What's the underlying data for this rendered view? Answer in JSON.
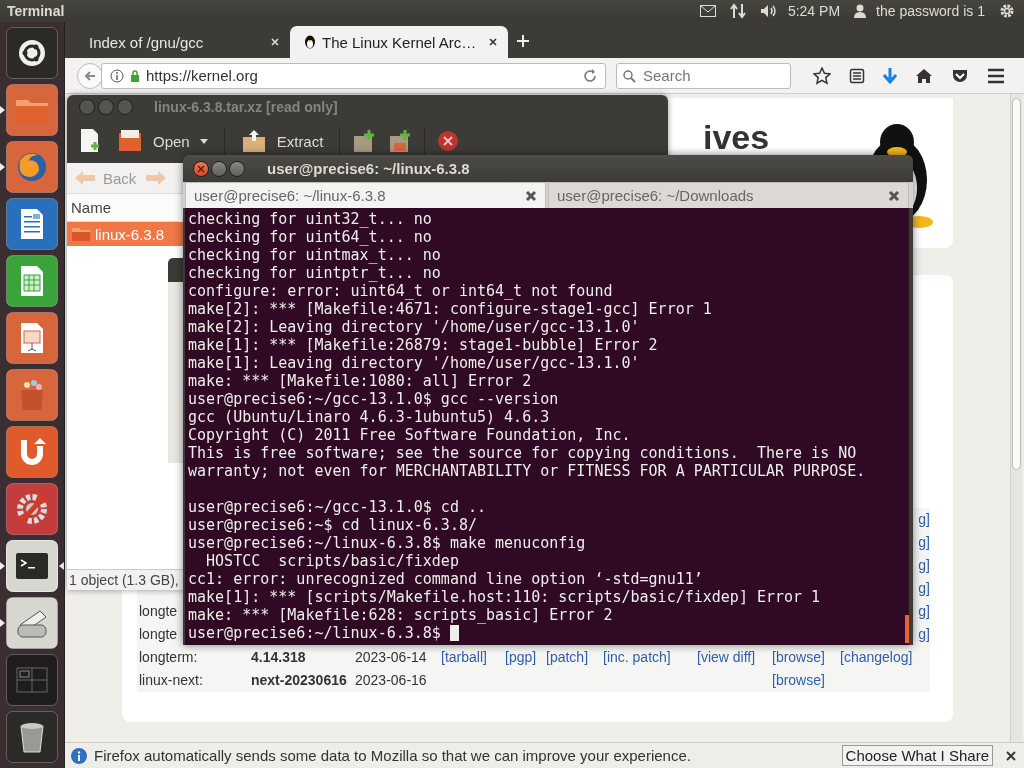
{
  "top_panel": {
    "app_name": "Terminal",
    "clock": "5:24 PM",
    "user": "the password is 1"
  },
  "launcher": [
    {
      "kind": "dash",
      "running": false,
      "focused": false
    },
    {
      "kind": "folder",
      "running": true,
      "focused": false
    },
    {
      "kind": "browser",
      "running": true,
      "focused": false
    },
    {
      "kind": "writer",
      "running": false,
      "focused": false
    },
    {
      "kind": "calc",
      "running": false,
      "focused": false
    },
    {
      "kind": "impress",
      "running": false,
      "focused": false
    },
    {
      "kind": "software",
      "running": false,
      "focused": false
    },
    {
      "kind": "one",
      "running": false,
      "focused": false
    },
    {
      "kind": "settings",
      "running": false,
      "focused": false
    },
    {
      "kind": "terminal",
      "running": true,
      "focused": true
    },
    {
      "kind": "scanner",
      "running": true,
      "focused": false
    },
    {
      "kind": "workspaces",
      "running": false,
      "focused": false
    },
    {
      "kind": "trash",
      "running": false,
      "focused": false
    }
  ],
  "browser": {
    "tabs": [
      {
        "title": "Index of /gnu/gcc",
        "selected": false
      },
      {
        "title": "The Linux Kernel Arc…",
        "selected": true
      }
    ],
    "address": "https://kernel.org",
    "search": {
      "placeholder": "Search"
    },
    "page": {
      "heading": "ives",
      "releases": [
        {
          "kind": "partial",
          "tail": "g]"
        },
        {
          "kind": "partial",
          "tail": "g]"
        },
        {
          "kind": "partial",
          "tail": "g]"
        },
        {
          "kind": "partial",
          "tail": "g]"
        },
        {
          "kind": "partial",
          "label": "longte",
          "tail": "g]"
        },
        {
          "kind": "partial",
          "label": "longte",
          "tail": "g]"
        },
        {
          "kind": "full",
          "label": "longterm:",
          "version": "4.14.318",
          "date": "2023-06-14",
          "links": [
            {
              "kind": "tarball",
              "label": "[tarball]"
            },
            {
              "kind": "pgp",
              "label": "[pgp]"
            },
            {
              "kind": "patch",
              "label": "[patch]"
            },
            {
              "kind": "inc-patch",
              "label": "[inc. patch]"
            },
            {
              "kind": "view-diff",
              "label": "[view diff]"
            },
            {
              "kind": "browse",
              "label": "[browse]"
            },
            {
              "kind": "changelog",
              "label": "[changelog]"
            }
          ]
        },
        {
          "kind": "full",
          "label": "linux-next:",
          "version": "next-20230616",
          "date": "2023-06-16",
          "links": [
            {
              "kind": "browse",
              "label": "[browse]"
            }
          ]
        }
      ]
    },
    "notification": {
      "message": "Firefox automatically sends some data to Mozilla so that we can improve your experience.",
      "button": "Choose What I Share"
    }
  },
  "archive_manager": {
    "title": "linux-6.3.8.tar.xz [read only]",
    "open": "Open",
    "extract": "Extract",
    "back": "Back",
    "column": "Name",
    "rows": [
      {
        "name": "linux-6.3.8",
        "selected": true
      }
    ],
    "status": "1 object (1.3 GB),"
  },
  "terminal": {
    "title": "user@precise6: ~/linux-6.3.8",
    "tabs": [
      {
        "title": "user@precise6: ~/linux-6.3.8",
        "selected": true
      },
      {
        "title": "user@precise6: ~/Downloads",
        "selected": false
      }
    ],
    "lines": [
      {
        "text": "checking for uint32_t... no"
      },
      {
        "text": "checking for uint64_t... no"
      },
      {
        "text": "checking for uintmax_t... no"
      },
      {
        "text": "checking for uintptr_t... no"
      },
      {
        "text": "configure: error: uint64_t or int64_t not found"
      },
      {
        "text": "make[2]: *** [Makefile:4671: configure-stage1-gcc] Error 1"
      },
      {
        "text": "make[2]: Leaving directory '/home/user/gcc-13.1.0'"
      },
      {
        "text": "make[1]: *** [Makefile:26879: stage1-bubble] Error 2"
      },
      {
        "text": "make[1]: Leaving directory '/home/user/gcc-13.1.0'"
      },
      {
        "text": "make: *** [Makefile:1080: all] Error 2"
      },
      {
        "text": "user@precise6:~/gcc-13.1.0$ gcc --version"
      },
      {
        "text": "gcc (Ubuntu/Linaro 4.6.3-1ubuntu5) 4.6.3"
      },
      {
        "text": "Copyright (C) 2011 Free Software Foundation, Inc."
      },
      {
        "text": "This is free software; see the source for copying conditions.  There is NO"
      },
      {
        "text": "warranty; not even for MERCHANTABILITY or FITNESS FOR A PARTICULAR PURPOSE."
      },
      {
        "text": "user@precise6:~/gcc-13.1.0$ cd ..",
        "gap_before": true
      },
      {
        "text": "user@precise6:~$ cd linux-6.3.8/"
      },
      {
        "text": "user@precise6:~/linux-6.3.8$ make menuconfig"
      },
      {
        "text": "  HOSTCC  scripts/basic/fixdep"
      },
      {
        "text": "cc1: error: unrecognized command line option ‘-std=gnu11’"
      },
      {
        "text": "make[1]: *** [scripts/Makefile.host:110: scripts/basic/fixdep] Error 1"
      },
      {
        "text": "make: *** [Makefile:628: scripts_basic] Error 2"
      },
      {
        "text": "user@precise6:~/linux-6.3.8$ "
      }
    ],
    "cursor": true
  }
}
